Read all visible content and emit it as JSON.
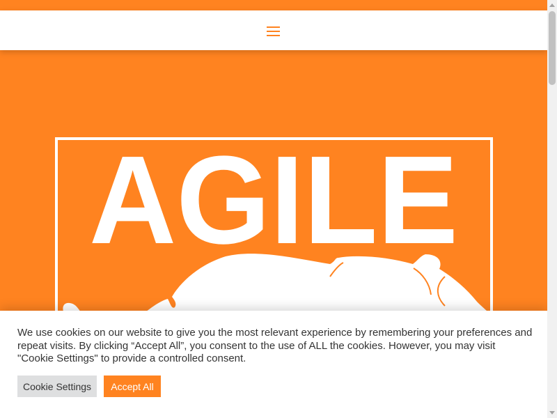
{
  "header": {
    "menu_icon": "hamburger-menu-icon"
  },
  "hero": {
    "logo_text": "AGILE",
    "logo_icon": "big-cat-silhouette"
  },
  "cookie_banner": {
    "message": "We use cookies on our website to give you the most relevant experience by remembering your preferences and repeat visits. By clicking “Accept All”, you consent to the use of ALL the cookies. However, you may visit \"Cookie Settings\" to provide a controlled consent.",
    "settings_label": "Cookie Settings",
    "accept_label": "Accept All"
  },
  "colors": {
    "brand_orange": "#ff8320",
    "white": "#ffffff",
    "button_gray": "#dedfe0",
    "text": "#333333"
  }
}
